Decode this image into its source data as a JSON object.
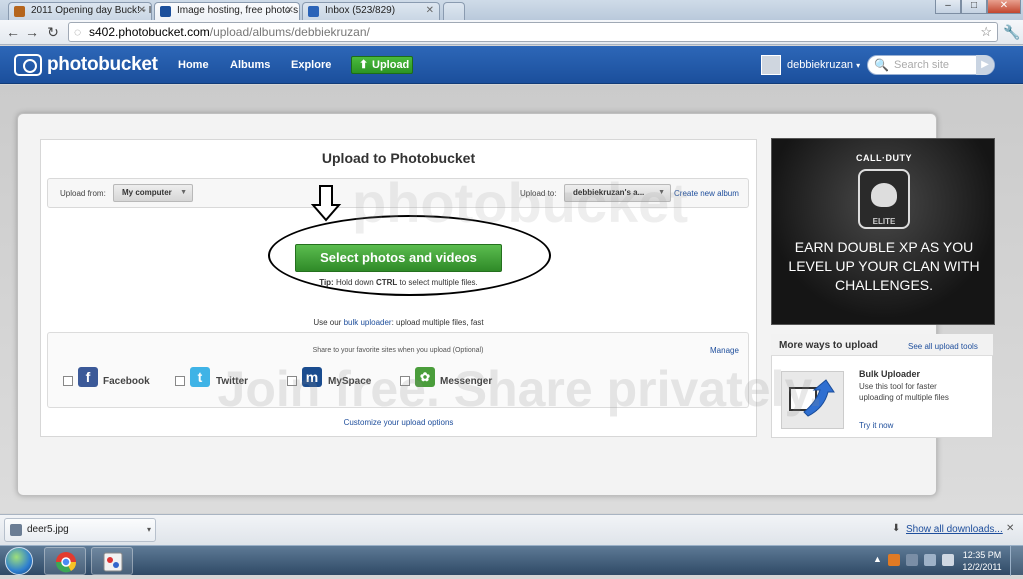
{
  "browser": {
    "tabs": [
      {
        "title": "2011 Opening day Buck! - I",
        "favicon_color": "#b5651d"
      },
      {
        "title": "Image hosting, free photo s",
        "favicon_color": "#1b4f9c"
      },
      {
        "title": "Inbox (523/829)",
        "favicon_color": "#2a63b8"
      }
    ],
    "url_host": "s402.photobucket.com",
    "url_path": "/upload/albums/debbiekruzan/",
    "window_buttons": [
      "–",
      "□",
      "✕"
    ]
  },
  "header": {
    "logo": "photobucket",
    "nav": [
      "Home",
      "Albums",
      "Explore"
    ],
    "upload_label": "Upload",
    "username": "debbiekruzan",
    "search_placeholder": "Search site"
  },
  "upload": {
    "title": "Upload to Photobucket",
    "from_label": "Upload from:",
    "from_value": "My computer",
    "to_label": "Upload to:",
    "to_value": "debbiekruzan's a...",
    "create_album": "Create new album",
    "select_button": "Select photos and videos",
    "tip_prefix": "Tip:",
    "tip_mid": " Hold down ",
    "tip_key": "CTRL",
    "tip_suffix": " to select multiple files.",
    "bulk_prefix": "Use our ",
    "bulk_link": "bulk uploader",
    "bulk_suffix": ": upload multiple files, fast",
    "share_text": "Share to your favorite sites when you upload (Optional)",
    "manage": "Manage",
    "share_sites": [
      {
        "name": "Facebook",
        "icon": "facebook-icon",
        "color": "#3b5998",
        "glyph": "f"
      },
      {
        "name": "Twitter",
        "icon": "twitter-icon",
        "color": "#3fb3e6",
        "glyph": "t"
      },
      {
        "name": "MySpace",
        "icon": "myspace-icon",
        "color": "#1a4c8f",
        "glyph": "m"
      },
      {
        "name": "Messenger",
        "icon": "messenger-icon",
        "color": "#4a9d3b",
        "glyph": "✿"
      }
    ],
    "customize": "Customize your upload options"
  },
  "ad": {
    "brand": "CALL·DUTY",
    "sub": "ELITE",
    "line1": "EARN DOUBLE XP AS YOU",
    "line2": "LEVEL UP YOUR CLAN WITH",
    "line3": "CHALLENGES."
  },
  "more_ways": {
    "title": "More ways to upload",
    "see_all": "See all upload tools",
    "tool_title": "Bulk Uploader",
    "tool_desc1": "Use this tool for faster",
    "tool_desc2": "uploading of multiple files",
    "try": "Try it now"
  },
  "watermark": {
    "top": "photobucket",
    "bottom": "Join free. Share privately."
  },
  "downloads": {
    "file": "deer5.jpg",
    "show_all": "Show all downloads...",
    "close": "✕"
  },
  "taskbar": {
    "time": "12:35 PM",
    "date": "12/2/2011"
  }
}
